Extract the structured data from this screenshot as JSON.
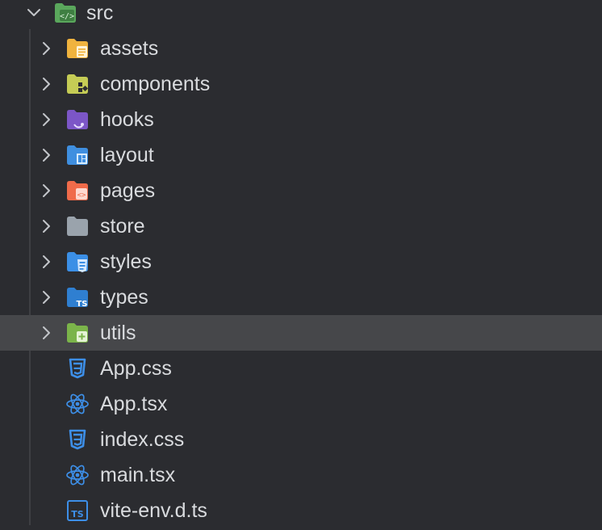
{
  "root": {
    "label": "src",
    "icon": "code-folder-icon",
    "expanded": true,
    "color": "#5aa75c"
  },
  "items": [
    {
      "label": "assets",
      "kind": "folder",
      "icon": "assets-folder-icon",
      "color": "#f0b33e"
    },
    {
      "label": "components",
      "kind": "folder",
      "icon": "components-folder-icon",
      "color": "#c5cc55"
    },
    {
      "label": "hooks",
      "kind": "folder",
      "icon": "hooks-folder-icon",
      "color": "#7c56c7"
    },
    {
      "label": "layout",
      "kind": "folder",
      "icon": "layout-folder-icon",
      "color": "#3f8fe0"
    },
    {
      "label": "pages",
      "kind": "folder",
      "icon": "pages-folder-icon",
      "color": "#f06b4a"
    },
    {
      "label": "store",
      "kind": "folder",
      "icon": "store-folder-icon",
      "color": "#9aa3ac"
    },
    {
      "label": "styles",
      "kind": "folder",
      "icon": "styles-folder-icon",
      "color": "#3b8fe6"
    },
    {
      "label": "types",
      "kind": "folder",
      "icon": "types-folder-icon",
      "color": "#2f7fd1"
    },
    {
      "label": "utils",
      "kind": "folder",
      "icon": "utils-folder-icon",
      "color": "#7bb44a",
      "selected": true
    },
    {
      "label": "App.css",
      "kind": "file",
      "icon": "css-file-icon",
      "color": "#3d8fe8"
    },
    {
      "label": "App.tsx",
      "kind": "file",
      "icon": "react-file-icon",
      "color": "#3d8fe8"
    },
    {
      "label": "index.css",
      "kind": "file",
      "icon": "css-file-icon",
      "color": "#3d8fe8"
    },
    {
      "label": "main.tsx",
      "kind": "file",
      "icon": "react-file-icon",
      "color": "#3d8fe8"
    },
    {
      "label": "vite-env.d.ts",
      "kind": "file",
      "icon": "ts-file-icon",
      "color": "#3d8fe8"
    }
  ],
  "colors": {
    "background": "#2b2c30",
    "selected_row": "#46474a",
    "text": "#d9dbde",
    "chevron": "#c3c6ca"
  }
}
